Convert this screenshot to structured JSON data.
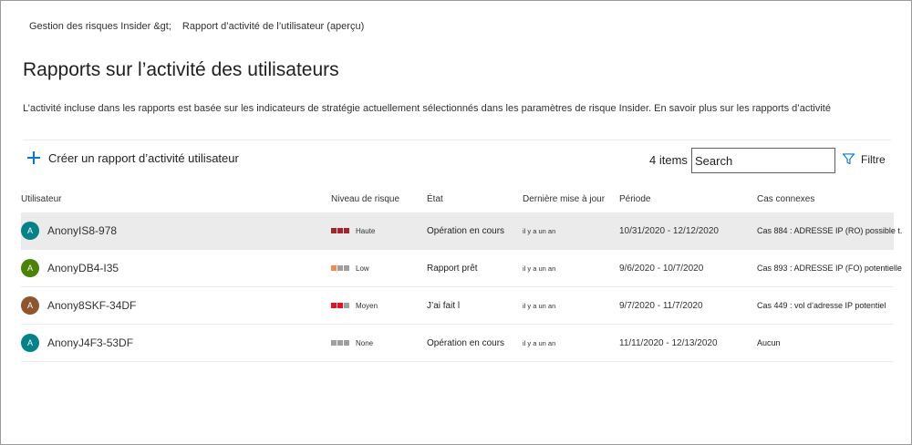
{
  "breadcrumb": {
    "parent": "Gestion des risques Insider &gt;",
    "current": "Rapport d’activité de l’utilisateur (aperçu)"
  },
  "page": {
    "title": "Rapports sur l’activité des utilisateurs",
    "description": "L’activité incluse dans les rapports est basée sur les indicateurs de stratégie actuellement sélectionnés dans les paramètres de risque Insider. En savoir plus sur les rapports d’activité"
  },
  "toolbar": {
    "create_label": "Créer un rapport d’activité utilisateur",
    "items_count": "4 items",
    "search_value": "Search",
    "filter_label": "Filtre"
  },
  "table": {
    "headers": {
      "user": "Utilisateur",
      "risk": "Niveau de risque",
      "state": "État",
      "updated": "Dernière mise à jour",
      "period": "Période",
      "cases": "Cas connexes"
    },
    "rows": [
      {
        "initial": "A",
        "avatar_color": "#038387",
        "user": "AnonyIS8-978",
        "risk": "Haute",
        "risk_colors": [
          "#a4262c",
          "#a4262c",
          "#a4262c"
        ],
        "state": "Opération en cours",
        "updated": "il y a un an",
        "period": "10/31/2020 - 12/12/2020",
        "cases": "Cas 884 : ADRESSE IP (RO) possible t...",
        "selected": true
      },
      {
        "initial": "A",
        "avatar_color": "#498205",
        "user": "AnonyDB4-I35",
        "risk": "Low",
        "risk_colors": [
          "#f7894a",
          "#a19f9d",
          "#a19f9d"
        ],
        "state": "Rapport prêt",
        "updated": "il y a un an",
        "period": "9/6/2020 - 10/7/2020",
        "cases": "Cas 893 : ADRESSE IP (FO) potentielle",
        "selected": false
      },
      {
        "initial": "A",
        "avatar_color": "#8e562e",
        "user": "Anony8SKF-34DF",
        "risk": "Moyen",
        "risk_colors": [
          "#e81123",
          "#e81123",
          "#a19f9d"
        ],
        "state": "J’ai fait l",
        "updated": "il y a un an",
        "period": "9/7/2020 - 11/7/2020",
        "cases": "Cas 449 : vol d’adresse IP potentiel",
        "selected": false
      },
      {
        "initial": "A",
        "avatar_color": "#038387",
        "user": "AnonyJ4F3-53DF",
        "risk": "None",
        "risk_colors": [
          "#a19f9d",
          "#a19f9d",
          "#a19f9d"
        ],
        "state": "Opération en cours",
        "updated": "il y a un an",
        "period": "11/11/2020 - 12/13/2020",
        "cases": "Aucun",
        "selected": false
      }
    ]
  }
}
